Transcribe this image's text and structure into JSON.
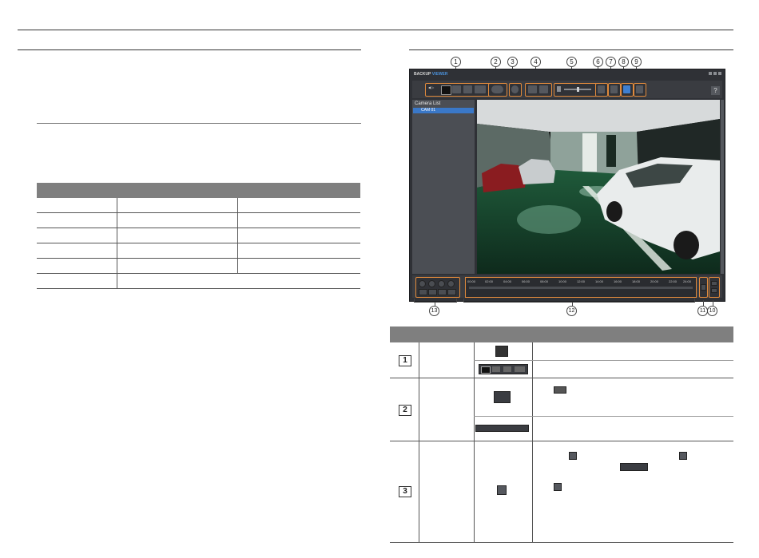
{
  "app": {
    "title_brand": "BACKUP",
    "title_suffix": "VIEWER",
    "help_label": "?",
    "camera_list_header": "Camera List",
    "camera_item": "CAM 01",
    "timeline_ticks": [
      "00:00",
      "02:00",
      "04:00",
      "06:00",
      "08:00",
      "10:00",
      "12:00",
      "14:00",
      "16:00",
      "18:00",
      "20:00",
      "22:00",
      "24:00"
    ]
  },
  "callouts": {
    "top": [
      "1",
      "2",
      "3",
      "4",
      "5",
      "6",
      "7",
      "8",
      "9"
    ],
    "bottom": [
      "13",
      "12",
      "11",
      "10"
    ]
  },
  "table": {
    "row_numbers": [
      "1",
      "2",
      "3"
    ]
  },
  "colors": {
    "accent_orange": "#e08a3c",
    "selection_blue": "#3a78c8",
    "header_gray": "#7f7f7f"
  }
}
